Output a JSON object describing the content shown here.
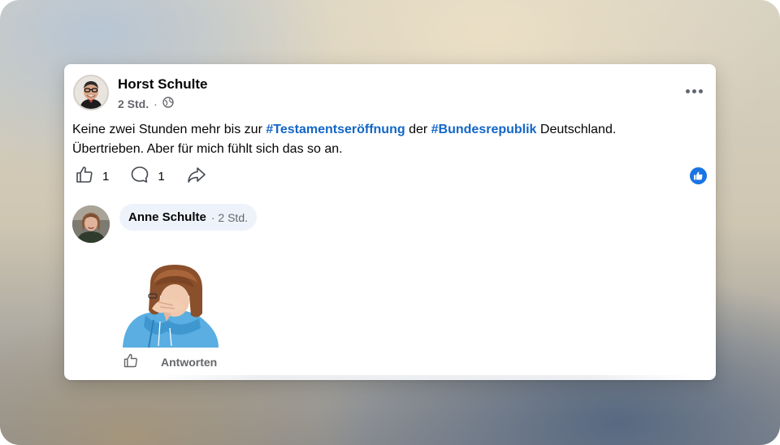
{
  "post": {
    "author": "Horst Schulte",
    "time": "2 Std.",
    "separator": "·",
    "audience_icon": "globe-icon",
    "more_icon": "more-horizontal-icon",
    "text_parts": {
      "p1": "Keine zwei Stunden mehr bis zur ",
      "tag1": "#Testamentseröffnung",
      "p2": " der ",
      "tag2": "#Bundesrepublik",
      "p3": " Deutschland.",
      "p4": "Übertrieben. Aber für mich fühlt sich das so an."
    },
    "like_count": "1",
    "comment_count": "1",
    "reaction_icon": "like-reaction-icon",
    "colors": {
      "hashtag": "#1366c7",
      "reaction": "#1b74e4"
    }
  },
  "comment": {
    "author": "Anne Schulte",
    "meta": "· 2 Std.",
    "sticker": "facepalm-avatar-sticker",
    "reply_label": "Antworten"
  }
}
